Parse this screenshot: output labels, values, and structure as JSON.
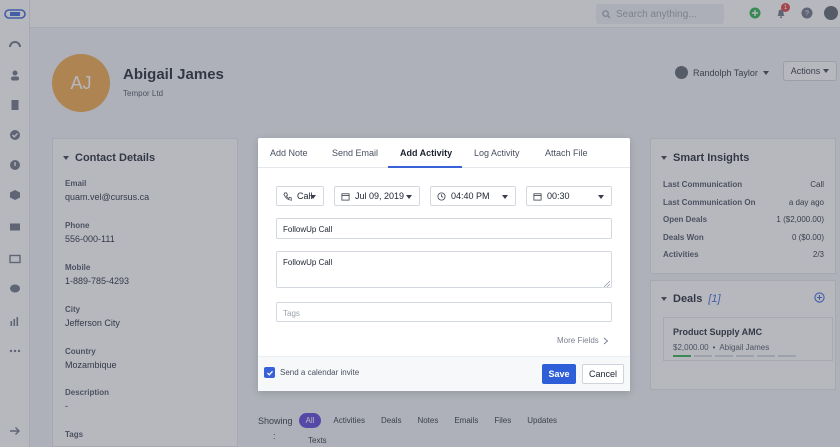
{
  "topbar": {
    "search_placeholder": "Search anything...",
    "notification_count": "1"
  },
  "contact": {
    "initials": "AJ",
    "name": "Abigail James",
    "company": "Tempor Ltd",
    "owner": "Randolph Taylor",
    "actions_label": "Actions"
  },
  "details": {
    "title": "Contact Details",
    "fields": [
      {
        "label": "Email",
        "value": "quam.vel@cursus.ca"
      },
      {
        "label": "Phone",
        "value": "556-000-111"
      },
      {
        "label": "Mobile",
        "value": "1-889-785-4293"
      },
      {
        "label": "City",
        "value": "Jefferson City"
      },
      {
        "label": "Country",
        "value": "Mozambique"
      },
      {
        "label": "Description",
        "value": "-"
      },
      {
        "label": "Tags",
        "value": ""
      }
    ]
  },
  "insights": {
    "title": "Smart Insights",
    "rows": [
      {
        "k": "Last Communication",
        "v": "Call"
      },
      {
        "k": "Last Communication On",
        "v": "a day ago"
      },
      {
        "k": "Open Deals",
        "v": "1 ($2,000.00)"
      },
      {
        "k": "Deals Won",
        "v": "0 ($0.00)"
      },
      {
        "k": "Activities",
        "v": "2/3"
      }
    ]
  },
  "deals": {
    "title": "Deals",
    "count": "[1]",
    "card_title": "Product Supply AMC",
    "card_amount": "$2,000.00",
    "card_owner": "Abigail James"
  },
  "bottom": {
    "showing": "Showing",
    "colon": ":",
    "tabs": [
      "All",
      "Activities",
      "Deals",
      "Notes",
      "Emails",
      "Files",
      "Updates"
    ],
    "texts": "Texts"
  },
  "modal": {
    "tabs": [
      "Add Note",
      "Send Email",
      "Add Activity",
      "Log Activity",
      "Attach File"
    ],
    "active_tab": "Add Activity",
    "activity_type": "Call",
    "date": "Jul 09, 2019",
    "time": "04:40 PM",
    "duration": "00:30",
    "title_value": "FollowUp Call",
    "description_value": "FollowUp Call",
    "tags_placeholder": "Tags",
    "more_fields": "More Fields",
    "calendar_invite_label": "Send a calendar invite",
    "save_label": "Save",
    "cancel_label": "Cancel"
  },
  "colors": {
    "accent": "#2f5fd8",
    "avatar": "#f0a646"
  }
}
